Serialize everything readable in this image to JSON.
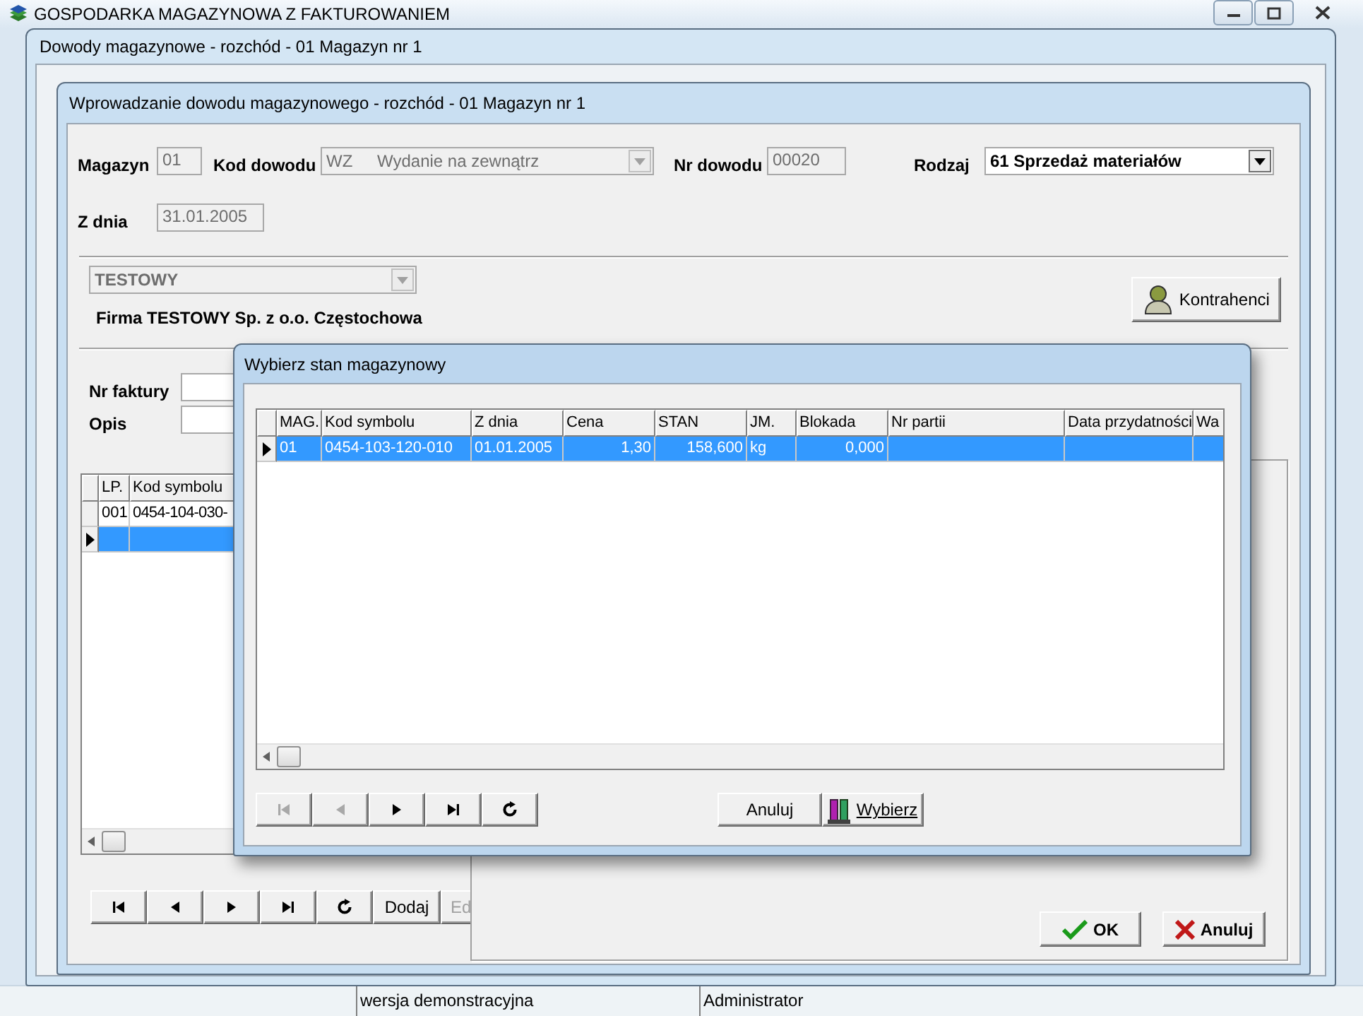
{
  "app_window": {
    "title": "GOSPODARKA MAGAZYNOWA Z FAKTUROWANIEM"
  },
  "documents_window": {
    "title": "Dowody magazynowe - rozchód - 01 Magazyn nr 1"
  },
  "entry_window": {
    "title": "Wprowadzanie dowodu magazynowego - rozchód - 01 Magazyn nr 1",
    "magazyn": {
      "label": "Magazyn",
      "value": "01",
      "disabled": true
    },
    "kod_dowodu": {
      "label": "Kod dowodu",
      "code": "WZ",
      "value": "Wydanie na zewnątrz",
      "disabled": true
    },
    "nr_dowodu": {
      "label": "Nr dowodu",
      "value": "00020",
      "disabled": true
    },
    "rodzaj": {
      "label": "Rodzaj",
      "value": "61 Sprzedaż materiałów",
      "disabled": false
    },
    "z_dnia": {
      "label": "Z dnia",
      "value": "31.01.2005",
      "disabled": true
    },
    "contractor": {
      "value": "TESTOWY",
      "disabled": true,
      "full_name": "Firma TESTOWY Sp. z o.o. Częstochowa"
    },
    "contractors_button": "Kontrahenci",
    "nr_faktury": {
      "label": "Nr faktury"
    },
    "opis": {
      "label": "Opis"
    },
    "items_table": {
      "columns": [
        "LP.",
        "Kod symbolu"
      ],
      "rows": [
        {
          "lp": "001",
          "kod": "0454-104-030-",
          "selected": false
        },
        {
          "selected": true
        }
      ]
    },
    "nav_buttons": [
      {
        "kind": "first",
        "disabled": false
      },
      {
        "kind": "prev",
        "disabled": false
      },
      {
        "kind": "next",
        "disabled": false
      },
      {
        "kind": "last",
        "disabled": false
      },
      {
        "kind": "refresh",
        "disabled": false
      }
    ],
    "text_buttons": [
      "Dodaj",
      "Ed"
    ],
    "ok_button": "OK",
    "cancel_button": "Anuluj"
  },
  "dialog": {
    "title": "Wybierz stan magazynowy",
    "columns": [
      "MAG.",
      "Kod symbolu",
      "Z dnia",
      "Cena",
      "STAN",
      "JM.",
      "Blokada",
      "Nr partii",
      "Data przydatności",
      "Wa"
    ],
    "rows": [
      {
        "cells": [
          "01",
          "0454-103-120-010",
          "01.01.2005",
          "1,30",
          "158,600",
          "kg",
          "0,000"
        ],
        "selected": true
      }
    ],
    "nav_buttons": [
      {
        "kind": "first",
        "disabled": true
      },
      {
        "kind": "prev",
        "disabled": true
      },
      {
        "kind": "next",
        "disabled": false
      },
      {
        "kind": "last",
        "disabled": false
      },
      {
        "kind": "refresh",
        "disabled": false
      }
    ],
    "cancel_button": "Anuluj",
    "choose_button": "Wybierz"
  },
  "status_bar": [
    "wersja demonstracyjna",
    "Administrator"
  ]
}
